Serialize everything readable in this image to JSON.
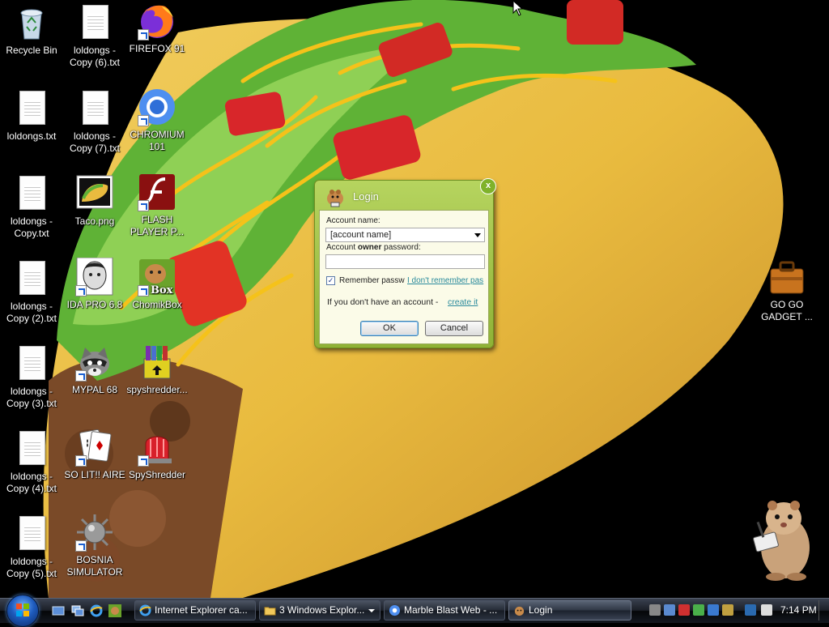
{
  "desktop_icons": [
    {
      "label": "Recycle Bin",
      "icon": "recycle-bin-icon"
    },
    {
      "label": "loldongs.txt",
      "icon": "text-file-icon"
    },
    {
      "label": "loldongs - Copy.txt",
      "icon": "text-file-icon"
    },
    {
      "label": "loldongs - Copy (2).txt",
      "icon": "text-file-icon"
    },
    {
      "label": "loldongs - Copy (3).txt",
      "icon": "text-file-icon"
    },
    {
      "label": "loldongs - Copy (4).txt",
      "icon": "text-file-icon"
    },
    {
      "label": "loldongs - Copy (5).txt",
      "icon": "text-file-icon"
    },
    {
      "label": "loldongs - Copy (6).txt",
      "icon": "text-file-icon"
    },
    {
      "label": "loldongs - Copy (7).txt",
      "icon": "text-file-icon"
    },
    {
      "label": "Taco.png",
      "icon": "image-file-icon"
    },
    {
      "label": "IDA PRO 6.8",
      "icon": "ida-pro-icon"
    },
    {
      "label": "MYPAL 68",
      "icon": "raccoon-browser-icon"
    },
    {
      "label": "SO LIT!! AIRE",
      "icon": "solitaire-cards-icon"
    },
    {
      "label": "BOSNIA SIMULATOR",
      "icon": "spiked-mine-icon"
    },
    {
      "label": "FIREFOX 91",
      "icon": "firefox-icon"
    },
    {
      "label": "CHROMIUM 101",
      "icon": "chromium-icon"
    },
    {
      "label": "FLASH PLAYER P...",
      "icon": "flash-player-icon"
    },
    {
      "label": "ChomikBox",
      "icon": "hamster-box-icon"
    },
    {
      "label": "spyshredder...",
      "icon": "installer-box-icon"
    },
    {
      "label": "SpyShredder",
      "icon": "red-siren-icon"
    },
    {
      "label": "GO GO GADGET ...",
      "icon": "briefcase-icon"
    }
  ],
  "login_dialog": {
    "title": "Login",
    "account_name_label": "Account name:",
    "account_name_value": "[account name]",
    "password_label_pre": "Account ",
    "password_label_bold": "owner",
    "password_label_post": " password:",
    "password_value": "",
    "remember_label": "Remember passw",
    "remember_checked": true,
    "forgot_link": "I don't remember pas",
    "no_account_text": "If you don't have an account - ",
    "create_link": "create it",
    "ok_label": "OK",
    "cancel_label": "Cancel",
    "close_glyph": "x"
  },
  "taskbar": {
    "buttons": [
      {
        "label": "Internet Explorer ca...",
        "icon": "ie-icon",
        "dropdown": false
      },
      {
        "label": "3 Windows Explor...",
        "icon": "folder-icon",
        "dropdown": true
      },
      {
        "label": "Marble Blast Web - ...",
        "icon": "chromium-icon",
        "dropdown": false
      },
      {
        "label": "Login",
        "icon": "hamster-icon",
        "dropdown": false
      }
    ],
    "clock": "7:14 PM"
  }
}
